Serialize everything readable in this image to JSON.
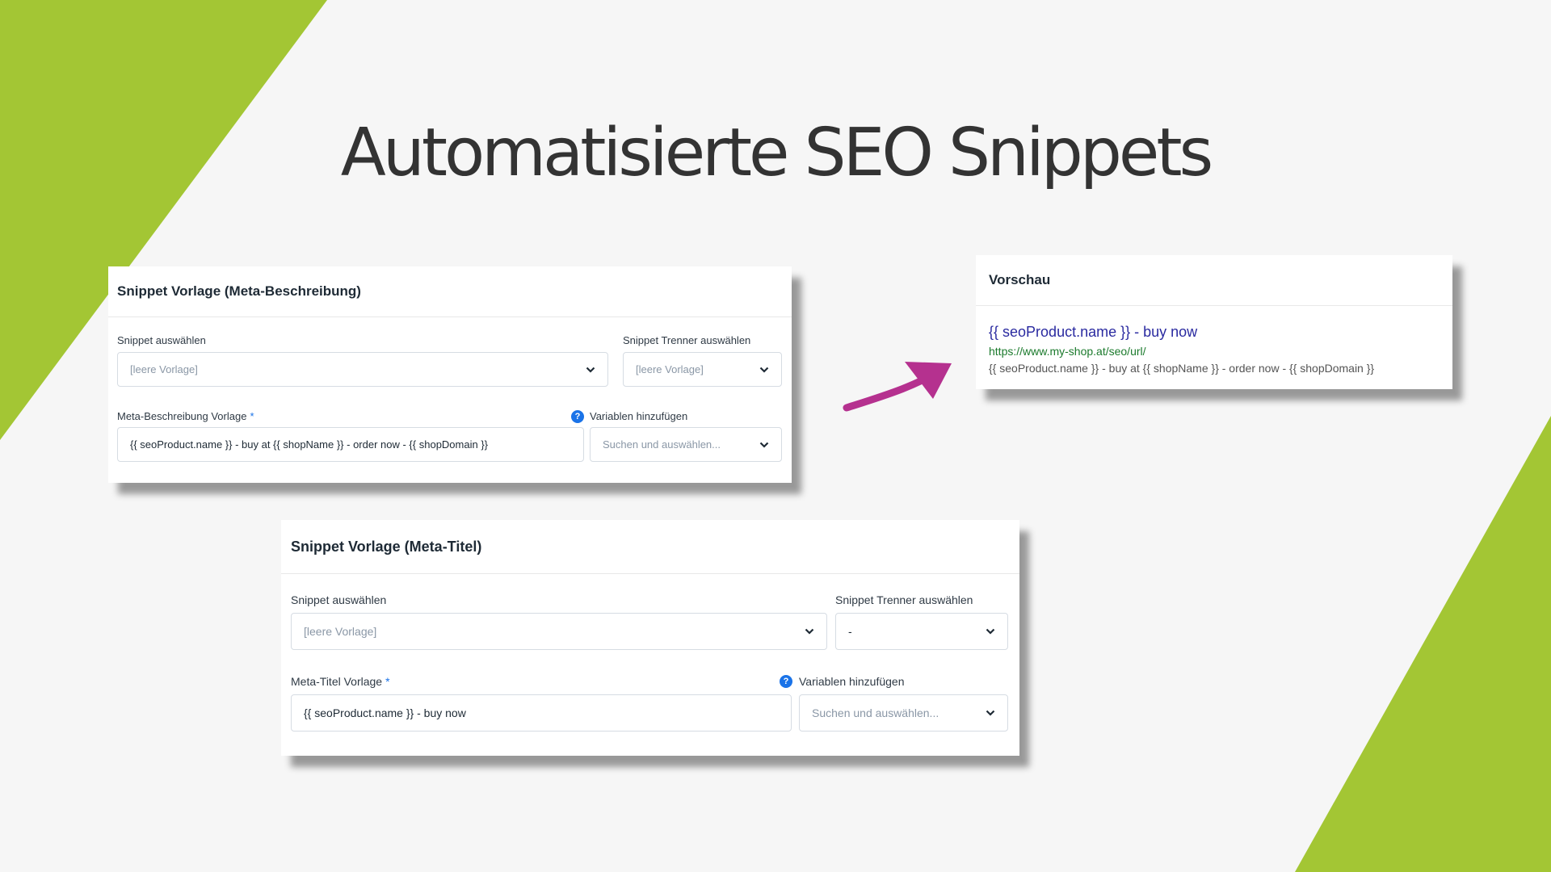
{
  "slide": {
    "title": "Automatisierte SEO Snippets"
  },
  "colors": {
    "accent_green": "#a3c634",
    "arrow_magenta": "#b5318f",
    "help_blue": "#1a73e8"
  },
  "description_card": {
    "header": "Snippet Vorlage (Meta-Beschreibung)",
    "snippet_label": "Snippet auswählen",
    "snippet_value": "[leere Vorlage]",
    "separator_label": "Snippet Trenner auswählen",
    "separator_value": "[leere Vorlage]",
    "template_label": "Meta-Beschreibung Vorlage",
    "required_mark": "*",
    "template_value": "{{ seoProduct.name }} - buy at {{ shopName }} - order now - {{ shopDomain }}",
    "help_icon": "?",
    "variables_label": "Variablen hinzufügen",
    "variables_placeholder": "Suchen und auswählen..."
  },
  "title_card": {
    "header": "Snippet Vorlage (Meta-Titel)",
    "snippet_label": "Snippet auswählen",
    "snippet_value": "[leere Vorlage]",
    "separator_label": "Snippet Trenner auswählen",
    "separator_value": "-",
    "template_label": "Meta-Titel Vorlage",
    "required_mark": "*",
    "template_value": "{{ seoProduct.name }} - buy now",
    "help_icon": "?",
    "variables_label": "Variablen hinzufügen",
    "variables_placeholder": "Suchen und auswählen..."
  },
  "preview_card": {
    "header": "Vorschau",
    "title": "{{ seoProduct.name }} - buy now",
    "url": "https://www.my-shop.at/seo/url/",
    "description": "{{ seoProduct.name }} - buy at {{ shopName }} - order now - {{ shopDomain }}"
  }
}
